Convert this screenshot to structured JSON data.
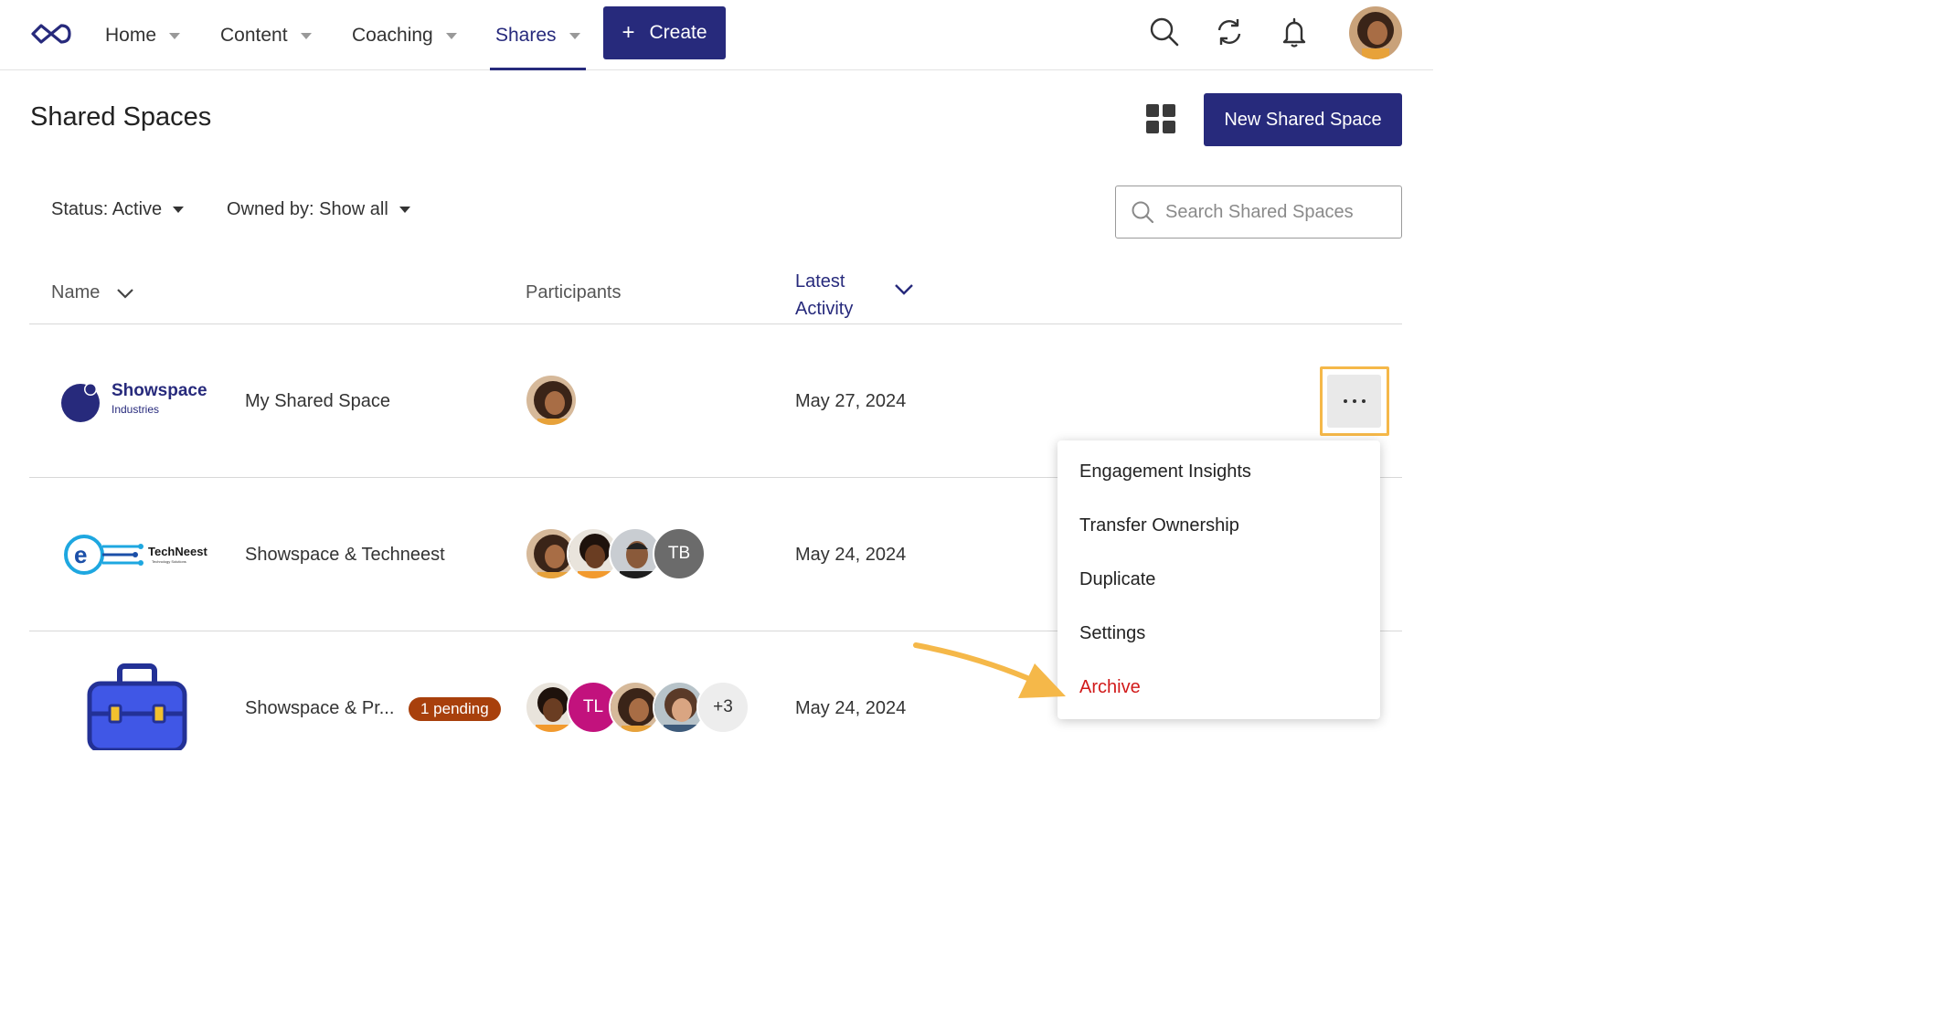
{
  "nav": {
    "items": [
      {
        "label": "Home"
      },
      {
        "label": "Content"
      },
      {
        "label": "Coaching"
      },
      {
        "label": "Shares"
      }
    ],
    "active": "Shares",
    "create_label": "Create",
    "icons": [
      "search-icon",
      "sync-icon",
      "bell-icon",
      "user-avatar"
    ]
  },
  "header": {
    "title": "Shared Spaces",
    "new_button": "New Shared Space"
  },
  "filters": {
    "status": "Status: Active",
    "owner": "Owned by: Show all",
    "search_placeholder": "Search Shared Spaces"
  },
  "table": {
    "col_name": "Name",
    "col_participants": "Participants",
    "col_latest_line1": "Latest",
    "col_latest_line2": "Activity",
    "rows": [
      {
        "logo_text": "Showspace",
        "logo_sub": "Industries",
        "name": "My Shared Space",
        "participants": [
          "photo"
        ],
        "date": "May 27, 2024"
      },
      {
        "logo_text": "TechNeest",
        "logo_sub": "Technology Solutions",
        "name": "Showspace & Techneest",
        "participants": [
          "photo",
          "photo",
          "photo",
          "TB"
        ],
        "date": "May 24, 2024"
      },
      {
        "name": "Showspace & Pr...",
        "badge": "1 pending",
        "participants": [
          "photo",
          "TL",
          "photo",
          "photo",
          "+3"
        ],
        "date": "May 24, 2024"
      }
    ]
  },
  "menu": {
    "items": [
      "Engagement Insights",
      "Transfer Ownership",
      "Duplicate",
      "Settings",
      "Archive"
    ]
  },
  "colors": {
    "brand": "#272a7c",
    "highlight": "#f5b849",
    "danger": "#d11a1a",
    "pending": "#a8400c",
    "tb_avatar": "#6b6b6b",
    "tl_avatar": "#c2127d"
  }
}
